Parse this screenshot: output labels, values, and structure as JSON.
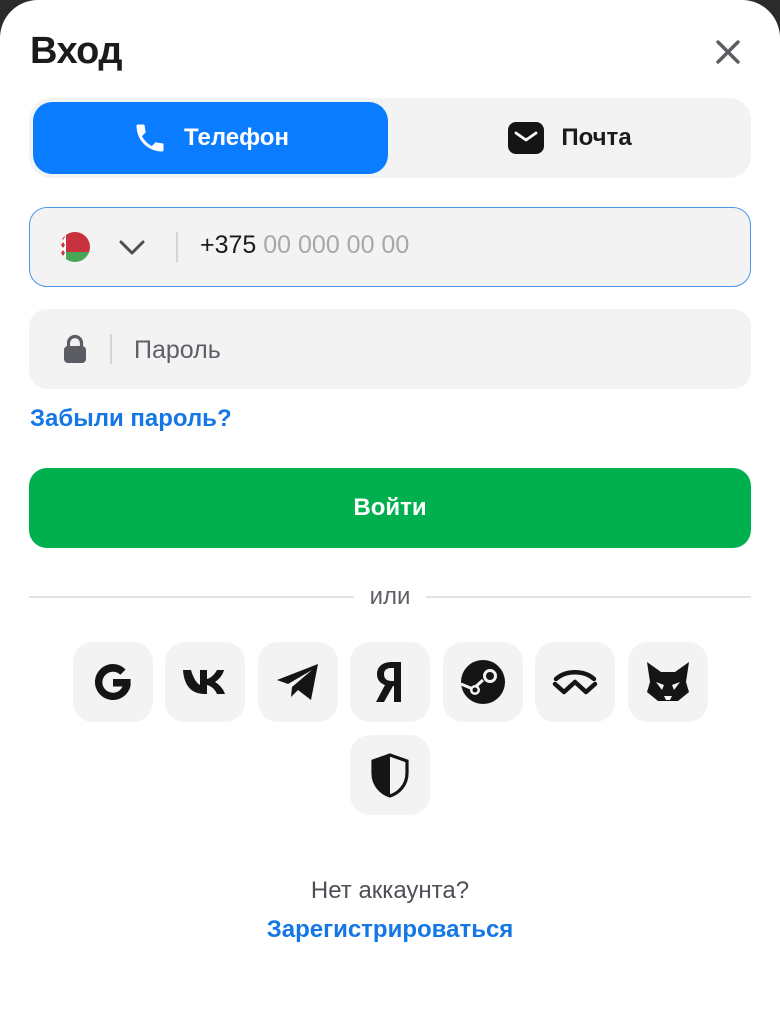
{
  "modal": {
    "title": "Вход"
  },
  "tabs": [
    {
      "label": "Телефон",
      "icon": "phone-icon",
      "active": true
    },
    {
      "label": "Почта",
      "icon": "mail-icon",
      "active": false
    }
  ],
  "phone": {
    "country_icon": "belarus-flag-icon",
    "prefix": "+375",
    "placeholder": "00 000 00 00"
  },
  "password": {
    "placeholder": "Пароль"
  },
  "forgot_password": "Забыли пароль?",
  "login_button": "Войти",
  "divider_text": "или",
  "social": [
    {
      "icon": "google-icon"
    },
    {
      "icon": "vk-icon"
    },
    {
      "icon": "telegram-icon"
    },
    {
      "icon": "yandex-icon"
    },
    {
      "icon": "steam-icon"
    },
    {
      "icon": "walletconnect-icon"
    },
    {
      "icon": "metamask-fox-icon"
    },
    {
      "icon": "shield-icon"
    }
  ],
  "footer": {
    "no_account": "Нет аккаунта?",
    "register": "Зарегистрироваться"
  },
  "colors": {
    "accent": "#0a7cff",
    "link": "#1477e6",
    "login": "#00b04f",
    "field_bg": "#f3f3f4"
  }
}
